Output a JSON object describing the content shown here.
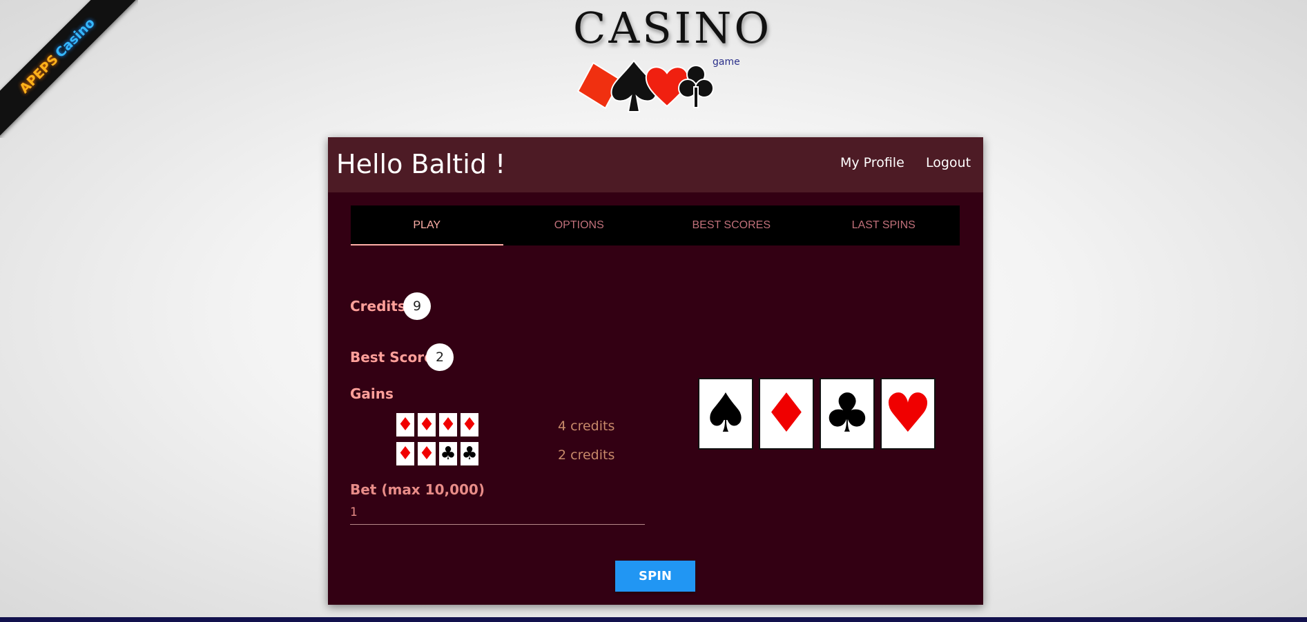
{
  "ribbon": {
    "part1": "APEPS",
    "part2": "Casino"
  },
  "logo": {
    "title": "CASINO",
    "subtitle": "game"
  },
  "header": {
    "greeting": "Hello Baltid !",
    "profile_link": "My Profile",
    "logout_link": "Logout"
  },
  "tabs": [
    {
      "label": "PLAY",
      "active": true
    },
    {
      "label": "OPTIONS",
      "active": false
    },
    {
      "label": "BEST SCORES",
      "active": false
    },
    {
      "label": "LAST SPINS",
      "active": false
    }
  ],
  "stats": {
    "credits_label": "Credits",
    "credits_value": "9",
    "best_score_label": "Best Score",
    "best_score_value": "2"
  },
  "gains": {
    "label": "Gains",
    "rows": [
      {
        "cards": [
          "diamond",
          "diamond",
          "diamond",
          "diamond"
        ],
        "payout": "4 credits"
      },
      {
        "cards": [
          "diamond",
          "diamond",
          "club",
          "club"
        ],
        "payout": "2 credits"
      }
    ]
  },
  "bet": {
    "label": "Bet (max 10,000)",
    "value": "1"
  },
  "spin_button": "SPIN",
  "slots": [
    "spade",
    "diamond",
    "club",
    "heart"
  ],
  "colors": {
    "panel_bg": "#330013",
    "header_bg": "#4d1b25",
    "accent": "#ffa09a",
    "spin_button": "#2196f3",
    "red_suit": "#f00000"
  }
}
